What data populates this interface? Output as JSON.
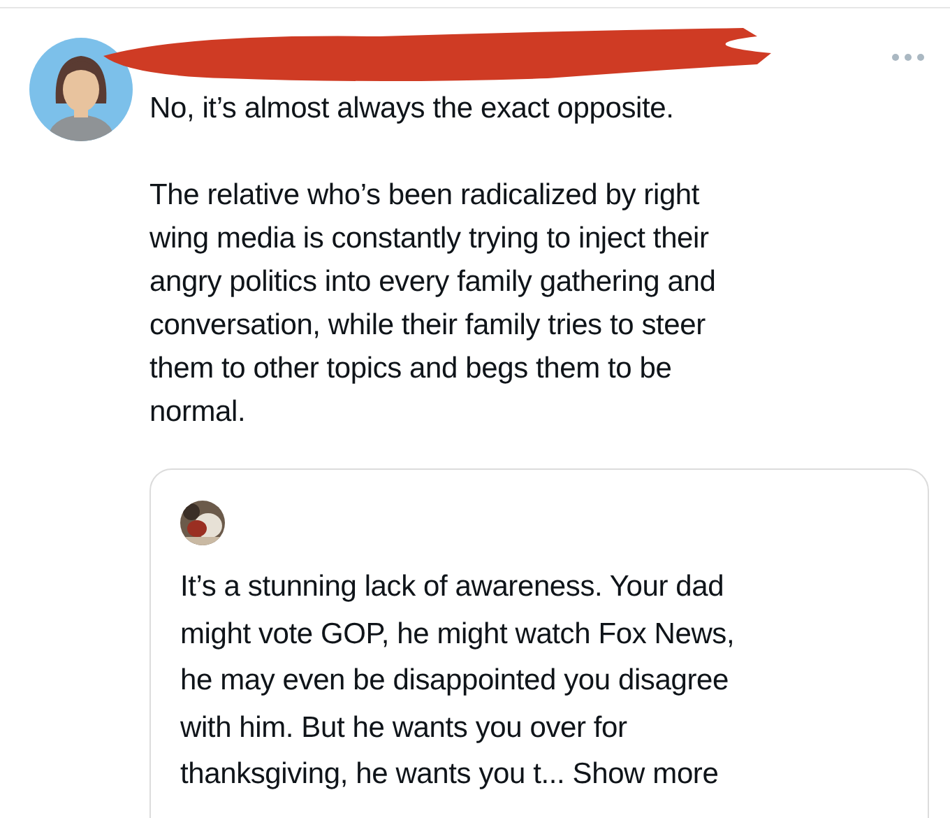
{
  "post": {
    "paragraphs": [
      "No, it’s almost always the exact opposite.",
      "The relative who’s been radicalized by right\nwing media is constantly trying to inject their\nangry politics into every family gathering and\nconversation, while their family tries to steer\nthem to other topics and begs them to be\nnormal."
    ],
    "quoted_post": {
      "text": "It’s a stunning lack of awareness. Your dad\nmight vote GOP, he might watch Fox News,\nhe may even be disappointed you disagree\nwith him. But he wants you over for\nthanksgiving, he wants you t...",
      "show_more": "Show more"
    }
  }
}
